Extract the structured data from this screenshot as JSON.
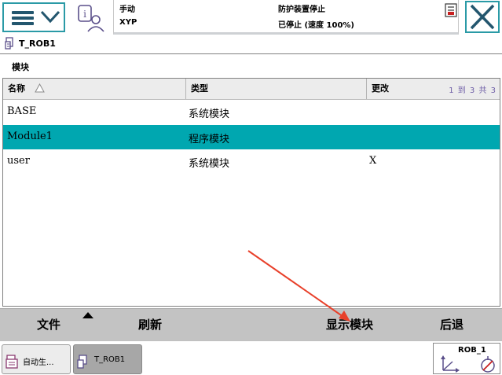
{
  "header": {
    "mode": "手动",
    "system": "XYP",
    "guard_status": "防护装置停止",
    "run_status": "已停止 (速度 100%)"
  },
  "task": {
    "name": "T_ROB1"
  },
  "section": {
    "title": "模块"
  },
  "table": {
    "columns": [
      "名称",
      "类型",
      "更改"
    ],
    "count": "1 到 3 共 3",
    "rows": [
      {
        "name": "BASE",
        "type": "系统模块",
        "changed": "",
        "selected": false
      },
      {
        "name": "Module1",
        "type": "程序模块",
        "changed": "",
        "selected": true
      },
      {
        "name": "user",
        "type": "系统模块",
        "changed": "X",
        "selected": false
      }
    ]
  },
  "commands": {
    "file": "文件",
    "refresh": "刷新",
    "show_module": "显示模块",
    "back": "后退"
  },
  "taskbar": {
    "tabs": [
      {
        "label": "自动生..."
      },
      {
        "label": "T_ROB1"
      }
    ],
    "robot": "ROB_1"
  },
  "colors": {
    "accent": "#2a9aa6",
    "selection": "#00a7b0",
    "annotation_arrow": "#e8402a"
  },
  "icons": [
    "hamburger-icon",
    "chevron-down-icon",
    "status-info-icon",
    "event-log-icon",
    "close-icon",
    "task-icon",
    "sort-asc-icon",
    "axes-icon",
    "target-icon"
  ]
}
